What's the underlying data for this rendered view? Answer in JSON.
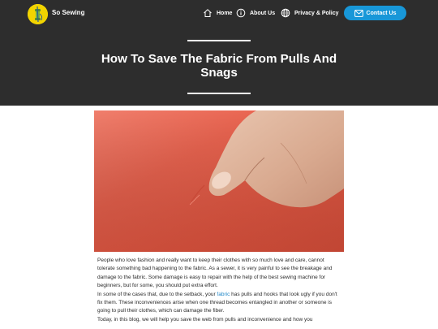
{
  "site": {
    "brand": "So Sewing",
    "logo_icon": "thread-spool-icon",
    "brand_color": "#f2d400"
  },
  "nav": {
    "items": [
      {
        "label": "Home",
        "icon": "home-icon"
      },
      {
        "label": "About Us",
        "icon": "info-circle-icon"
      },
      {
        "label": "Privacy & Policy",
        "icon": "globe-icon"
      }
    ],
    "contact": {
      "label": "Contact Us",
      "icon": "envelope-icon",
      "color": "#1897d8"
    }
  },
  "hero": {
    "title": "How To Save The Fabric From Pulls And Snags",
    "background": "#2d2d2d"
  },
  "featured_image": {
    "subject": "finger-pinching-snag-on-red-fabric"
  },
  "article": {
    "p1": "People who love fashion and really want to keep their clothes with so much love and care, cannot tolerate something bad happening to the fabric. As a sewer, it is very painful to see the breakage and damage to the fabric. Some damage is easy to repair with the help of the best sewing machine for beginners, but for some, you should put extra effort.",
    "p2_before": "In some of the cases that, due to the setback, your ",
    "p2_link": "fabric",
    "p2_after": " has pulls and hooks that look ugly if you don't fix them. These inconveniences arise when one thread becomes entangled in another or someone is going to pull their clothes, which can damage the fiber.",
    "p3": "Today, in this blog, we will help you save the web from pulls and inconvenience and how you",
    "link_color": "#1e86c8"
  }
}
